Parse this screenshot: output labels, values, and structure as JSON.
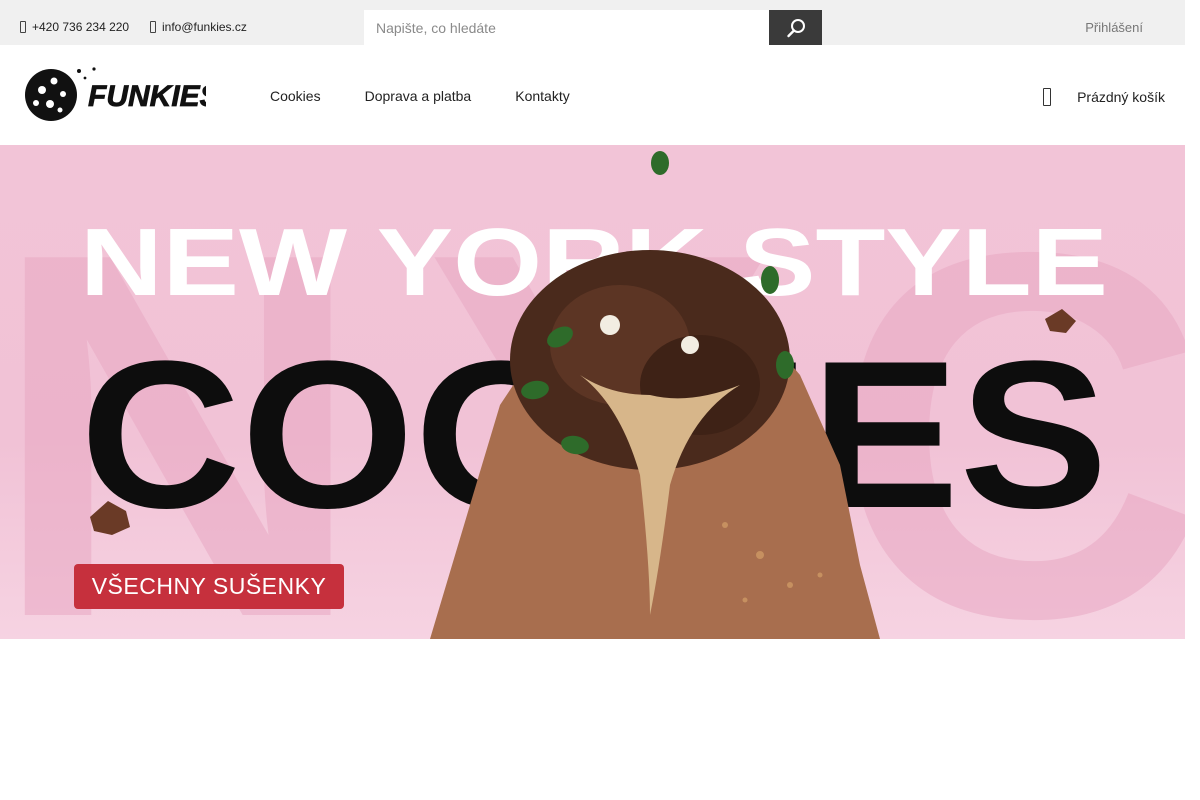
{
  "topbar": {
    "phone": "+420 736 234 220",
    "email": "info@funkies.cz",
    "search_placeholder": "Napište, co hledáte",
    "login_label": "Přihlášení"
  },
  "header": {
    "logo_text": "FUNKIES!",
    "nav": [
      "Cookies",
      "Doprava a platba",
      "Kontakty"
    ],
    "cart_label": "Prázdný košík"
  },
  "banner": {
    "headline_line1": "NEW YORK STYLE",
    "headline_line2": "COOKIES",
    "background_letters": "NYC",
    "cta_label": "VŠECHNY SUŠENKY",
    "bg_color": "#f2c4d7",
    "cta_color": "#c6303d"
  },
  "icons": {
    "phone": "phone-icon",
    "email": "mail-icon",
    "search": "search-icon",
    "cart": "cart-icon"
  }
}
